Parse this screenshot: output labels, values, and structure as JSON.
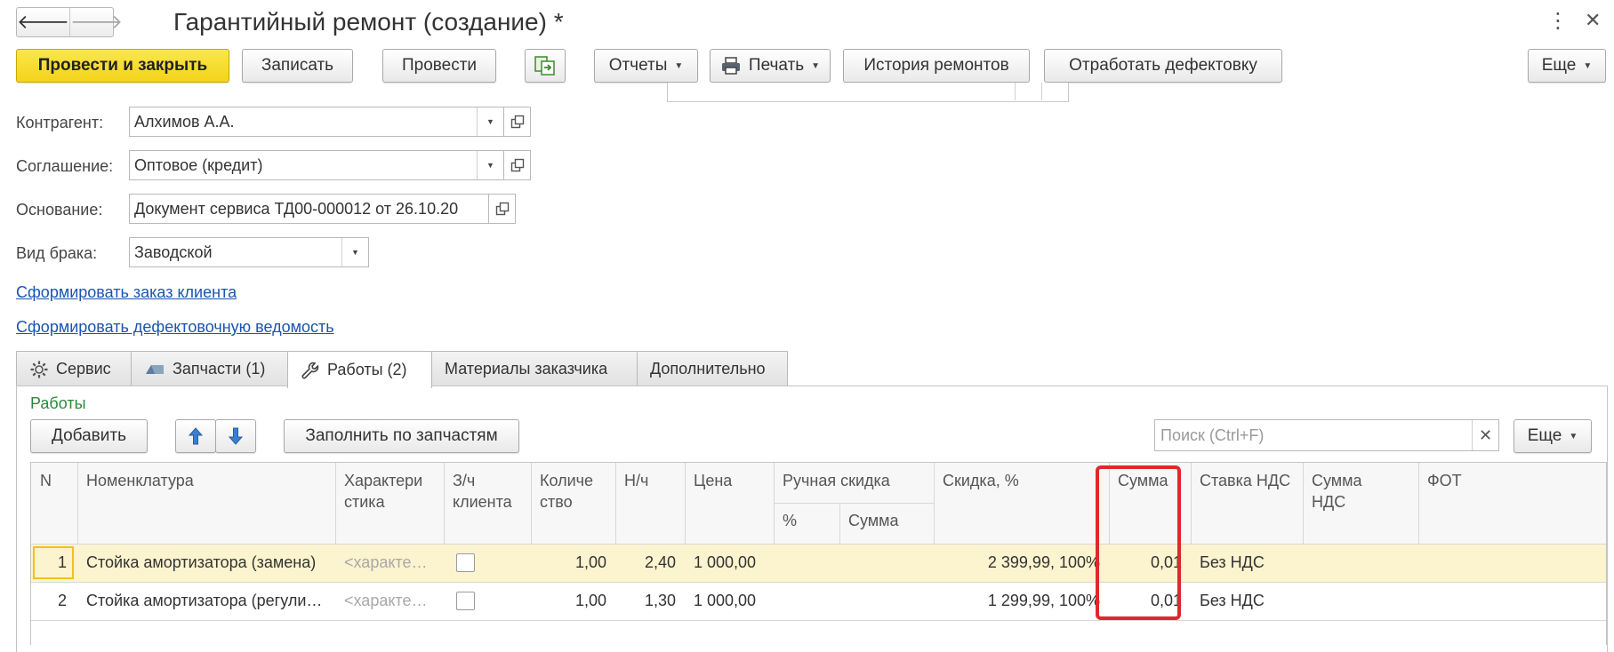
{
  "window": {
    "title": "Гарантийный ремонт (создание) *"
  },
  "toolbar": {
    "post_close": "Провести и закрыть",
    "save": "Записать",
    "post": "Провести",
    "reports": "Отчеты",
    "print": "Печать",
    "repair_history": "История ремонтов",
    "process_defects": "Отработать дефектовку",
    "more": "Еще"
  },
  "form": {
    "counterparty_label": "Контрагент:",
    "counterparty_value": "Алхимов А.А.",
    "agreement_label": "Соглашение:",
    "agreement_value": "Оптовое (кредит)",
    "basis_label": "Основание:",
    "basis_value": "Документ сервиса ТД00-000012 от 26.10.20",
    "defect_type_label": "Вид брака:",
    "defect_type_value": "Заводской",
    "link_client_order": "Сформировать заказ клиента",
    "link_defect_sheet": "Сформировать дефектовочную ведомость"
  },
  "tabs": [
    {
      "label": "Сервис",
      "icon": "gear-icon"
    },
    {
      "label": "Запчасти (1)",
      "icon": "parts-icon"
    },
    {
      "label": "Работы (2)",
      "icon": "wrench-icon",
      "active": true
    },
    {
      "label": "Материалы заказчика",
      "icon": ""
    },
    {
      "label": "Дополнительно",
      "icon": ""
    }
  ],
  "works": {
    "section_title": "Работы",
    "add": "Добавить",
    "fill_by_parts": "Заполнить по запчастям",
    "search_placeholder": "Поиск (Ctrl+F)",
    "more": "Еще",
    "columns": {
      "n": "N",
      "nomenclature": "Номенклатура",
      "characteristic": "Характери\nстика",
      "client_parts": "З/ч\nклиента",
      "quantity": "Количе\nство",
      "norm_hours": "Н/ч",
      "price": "Цена",
      "manual_discount": "Ручная скидка",
      "manual_discount_pct": "%",
      "manual_discount_sum": "Сумма",
      "discount_pct": "Скидка, %",
      "sum": "Сумма",
      "vat_rate": "Ставка НДС",
      "vat_sum": "Сумма\nНДС",
      "payroll": "ФОТ"
    },
    "rows": [
      {
        "n": "1",
        "nomenclature": "Стойка амортизатора (замена)",
        "characteristic": "<характеристика>",
        "client_parts": false,
        "quantity": "1,00",
        "norm_hours": "2,40",
        "price": "1 000,00",
        "manual_pct": "",
        "manual_sum": "",
        "discount": "2 399,99, 100%",
        "sum": "0,01",
        "vat_rate": "Без НДС",
        "vat_sum": "",
        "payroll": ""
      },
      {
        "n": "2",
        "nomenclature": "Стойка амортизатора (регулировка)",
        "characteristic": "<характеристика>",
        "client_parts": false,
        "quantity": "1,00",
        "norm_hours": "1,30",
        "price": "1 000,00",
        "manual_pct": "",
        "manual_sum": "",
        "discount": "1 299,99, 100%",
        "sum": "0,01",
        "vat_rate": "Без НДС",
        "vat_sum": "",
        "payroll": ""
      }
    ]
  },
  "colors": {
    "primary_button": "#f5d31c",
    "link": "#1a55b0",
    "section_title": "#2a8a3a",
    "selected_row": "#fcf3cf",
    "highlight_frame": "#e0282e"
  }
}
